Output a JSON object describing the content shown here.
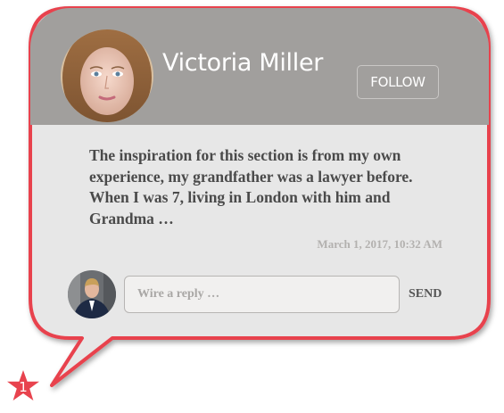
{
  "profile": {
    "name": "Victoria Miller",
    "follow_label": "FOLLOW"
  },
  "post": {
    "message": "The inspiration for this section is from my own experience, my grandfather was a lawyer before. When I was 7, living in London with him and Grandma …",
    "timestamp": "March 1, 2017, 10:32 AM"
  },
  "reply": {
    "placeholder": "Wire a reply …",
    "send_label": "SEND"
  },
  "badge": {
    "number": "1"
  },
  "colors": {
    "accent": "#e8434e",
    "header_bg": "#a19f9d",
    "card_bg": "#e7e7e7"
  }
}
